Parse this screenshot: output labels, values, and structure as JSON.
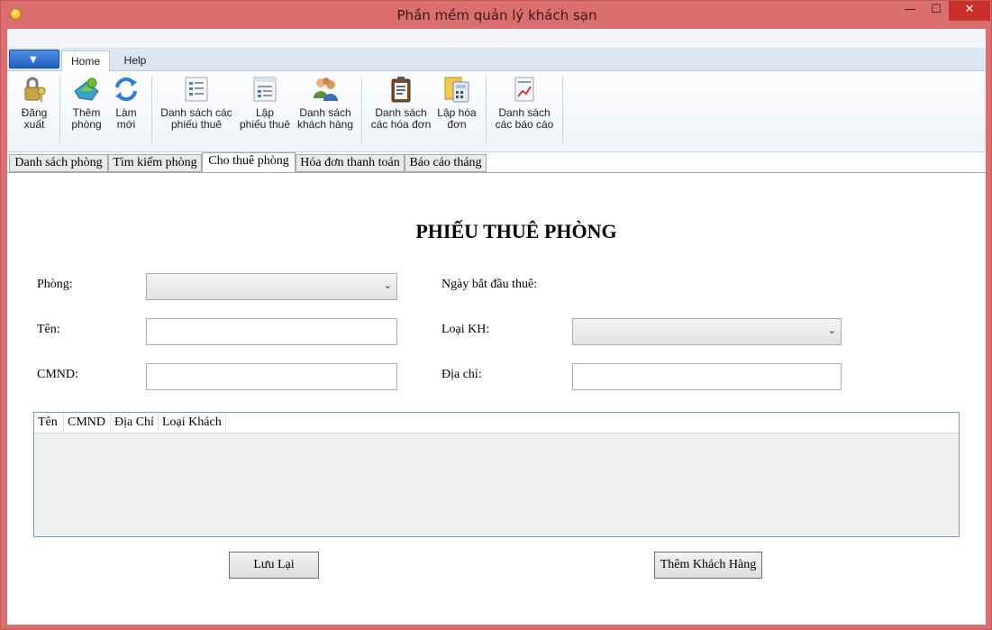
{
  "window": {
    "title": "Phần mềm quản lý khách sạn",
    "controls": {
      "minimize": "—",
      "maximize": "☐",
      "close": "✕"
    }
  },
  "ribbon": {
    "tabs": [
      {
        "label": "Home"
      },
      {
        "label": "Help"
      }
    ],
    "buttons": [
      {
        "line1": "Đăng",
        "line2": "xuất",
        "icon": "lock-key-icon"
      },
      {
        "line1": "Thêm",
        "line2": "phòng",
        "icon": "add-room-icon"
      },
      {
        "line1": "Làm",
        "line2": "mới",
        "icon": "refresh-icon"
      },
      {
        "line1": "Danh sách các",
        "line2": "phiếu thuê",
        "icon": "list-icon"
      },
      {
        "line1": "Lập",
        "line2": "phiếu thuê",
        "icon": "form-icon"
      },
      {
        "line1": "Danh sách",
        "line2": "khách hàng",
        "icon": "users-icon"
      },
      {
        "line1": "Danh sách",
        "line2": "các hóa đơn",
        "icon": "clipboard-icon"
      },
      {
        "line1": "Lập hóa",
        "line2": "đơn",
        "icon": "calculator-icon"
      },
      {
        "line1": "Danh sách",
        "line2": "các báo cáo",
        "icon": "report-icon"
      }
    ]
  },
  "tabs": [
    {
      "label": "Danh sách phòng"
    },
    {
      "label": "Tìm kiếm phòng"
    },
    {
      "label": "Cho thuê phòng"
    },
    {
      "label": "Hóa đơn thanh toán"
    },
    {
      "label": "Báo cáo tháng"
    }
  ],
  "form": {
    "title": "PHIẾU THUÊ PHÒNG",
    "room_label": "Phòng:",
    "name_label": "Tên:",
    "id_label": "CMND:",
    "start_date_label": "Ngày bắt đầu thuê:",
    "customer_type_label": "Loại KH:",
    "address_label": "Địa chỉ:",
    "name_value": "",
    "id_value": "",
    "address_value": ""
  },
  "grid": {
    "columns": [
      "Tên",
      "CMND",
      "Địa Chỉ",
      "Loại Khách"
    ]
  },
  "actions": {
    "save": "Lưu Lại",
    "add_customer": "Thêm Khách Hàng"
  }
}
